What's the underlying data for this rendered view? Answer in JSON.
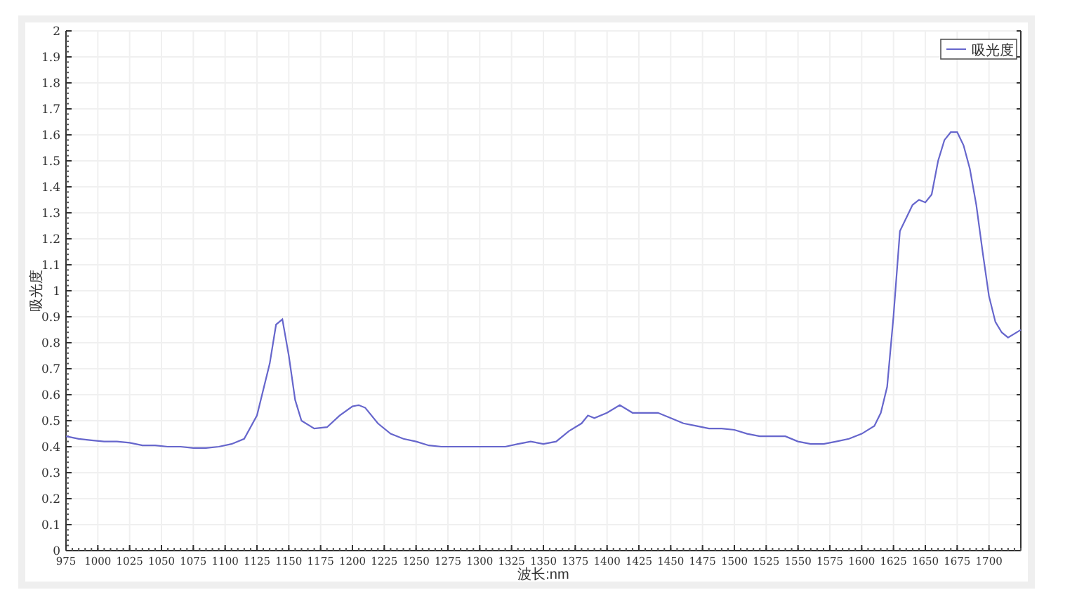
{
  "chart": {
    "chart_data": {
      "type": "line",
      "xlabel": "波长:nm",
      "ylabel": "吸光度",
      "x": [
        975,
        985,
        995,
        1005,
        1015,
        1025,
        1035,
        1045,
        1055,
        1065,
        1075,
        1085,
        1095,
        1105,
        1115,
        1125,
        1135,
        1140,
        1145,
        1150,
        1155,
        1160,
        1170,
        1180,
        1190,
        1200,
        1205,
        1210,
        1220,
        1230,
        1240,
        1250,
        1260,
        1270,
        1280,
        1290,
        1300,
        1310,
        1320,
        1330,
        1340,
        1350,
        1360,
        1370,
        1380,
        1385,
        1390,
        1400,
        1410,
        1420,
        1430,
        1440,
        1450,
        1460,
        1470,
        1480,
        1490,
        1500,
        1510,
        1520,
        1530,
        1540,
        1550,
        1560,
        1570,
        1580,
        1590,
        1600,
        1610,
        1615,
        1620,
        1625,
        1630,
        1640,
        1645,
        1650,
        1655,
        1660,
        1665,
        1670,
        1675,
        1680,
        1685,
        1690,
        1695,
        1700,
        1705,
        1710,
        1715,
        1725
      ],
      "series": [
        {
          "name": "吸光度",
          "color": "#6666cc",
          "values": [
            0.44,
            0.43,
            0.425,
            0.42,
            0.42,
            0.415,
            0.405,
            0.405,
            0.4,
            0.4,
            0.395,
            0.395,
            0.4,
            0.41,
            0.43,
            0.52,
            0.72,
            0.87,
            0.89,
            0.75,
            0.58,
            0.5,
            0.47,
            0.475,
            0.52,
            0.555,
            0.56,
            0.55,
            0.49,
            0.45,
            0.43,
            0.42,
            0.405,
            0.4,
            0.4,
            0.4,
            0.4,
            0.4,
            0.4,
            0.41,
            0.42,
            0.41,
            0.42,
            0.46,
            0.49,
            0.52,
            0.51,
            0.53,
            0.56,
            0.53,
            0.53,
            0.53,
            0.51,
            0.49,
            0.48,
            0.47,
            0.47,
            0.465,
            0.45,
            0.44,
            0.44,
            0.44,
            0.42,
            0.41,
            0.41,
            0.42,
            0.43,
            0.45,
            0.48,
            0.53,
            0.63,
            0.9,
            1.23,
            1.33,
            1.35,
            1.34,
            1.37,
            1.5,
            1.58,
            1.61,
            1.61,
            1.56,
            1.47,
            1.33,
            1.15,
            0.98,
            0.88,
            0.84,
            0.82,
            0.85
          ]
        }
      ],
      "grid": true,
      "xlim": [
        975,
        1725
      ],
      "ylim": [
        0,
        2
      ],
      "xticks": [
        975,
        1000,
        1025,
        1050,
        1075,
        1100,
        1125,
        1150,
        1175,
        1200,
        1225,
        1250,
        1275,
        1300,
        1325,
        1350,
        1375,
        1400,
        1425,
        1450,
        1475,
        1500,
        1525,
        1550,
        1575,
        1600,
        1625,
        1650,
        1675,
        1700
      ],
      "yticks": [
        0,
        0.1,
        0.2,
        0.3,
        0.4,
        0.5,
        0.6,
        0.7,
        0.8,
        0.9,
        1,
        1.1,
        1.2,
        1.3,
        1.4,
        1.5,
        1.6,
        1.7,
        1.8,
        1.9,
        2
      ]
    }
  }
}
